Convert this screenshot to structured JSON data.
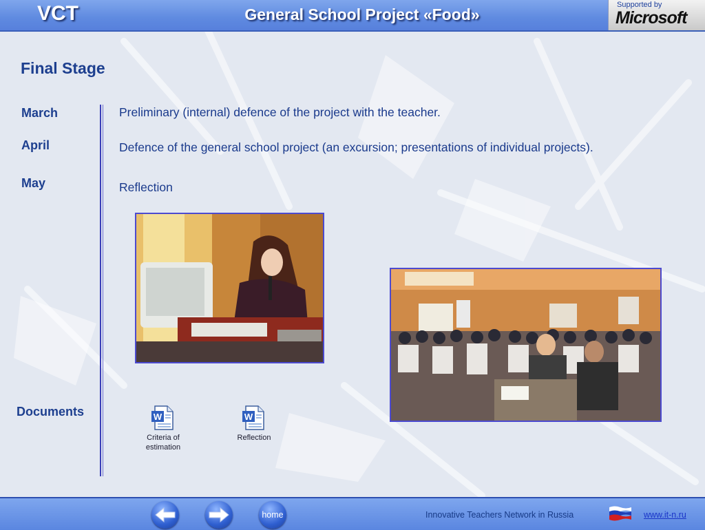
{
  "header": {
    "logo_text": "VCT",
    "title": "General School Project «Food»",
    "sponsor_caption": "Supported by",
    "sponsor_name": "Microsoft"
  },
  "main": {
    "page_title": "Final Stage",
    "schedule": [
      {
        "month": "March",
        "activity": "Preliminary (internal) defence of the project with the teacher."
      },
      {
        "month": "April",
        "activity": "Defence of the general school project (an excursion; presentations of individual projects)."
      },
      {
        "month": "May",
        "activity": "Reflection"
      }
    ],
    "documents_label": "Documents",
    "documents": [
      {
        "line1": "Criteria of",
        "line2": "estimation",
        "icon": "word-document-icon"
      },
      {
        "line1": "Reflection",
        "line2": "",
        "icon": "word-document-icon"
      }
    ]
  },
  "footer": {
    "home_label": "home",
    "network_text": "Innovative Teachers Network in Russia",
    "link_text": "www.it-n.ru",
    "flag_colors": [
      "#ffffff",
      "#1f3fb8",
      "#d21f1f"
    ]
  }
}
